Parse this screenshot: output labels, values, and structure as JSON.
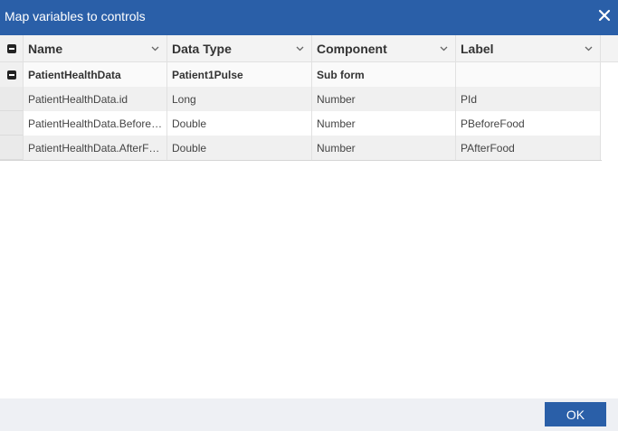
{
  "dialog": {
    "title": "Map variables to controls",
    "ok_label": "OK"
  },
  "grid": {
    "columns": [
      "Name",
      "Data Type",
      "Component",
      "Label"
    ],
    "group_row": {
      "name": "PatientHealthData",
      "data_type": "Patient1Pulse",
      "component": "Sub form",
      "label": ""
    },
    "rows": [
      {
        "name": "PatientHealthData.id",
        "data_type": "Long",
        "component": "Number",
        "label": "PId"
      },
      {
        "name": "PatientHealthData.Before…",
        "data_type": "Double",
        "component": "Number",
        "label": "PBeforeFood"
      },
      {
        "name": "PatientHealthData.AfterF…",
        "data_type": "Double",
        "component": "Number",
        "label": "PAfterFood"
      }
    ]
  },
  "colors": {
    "titlebar": "#2a5fa8",
    "ok_button": "#2a5fa8"
  }
}
